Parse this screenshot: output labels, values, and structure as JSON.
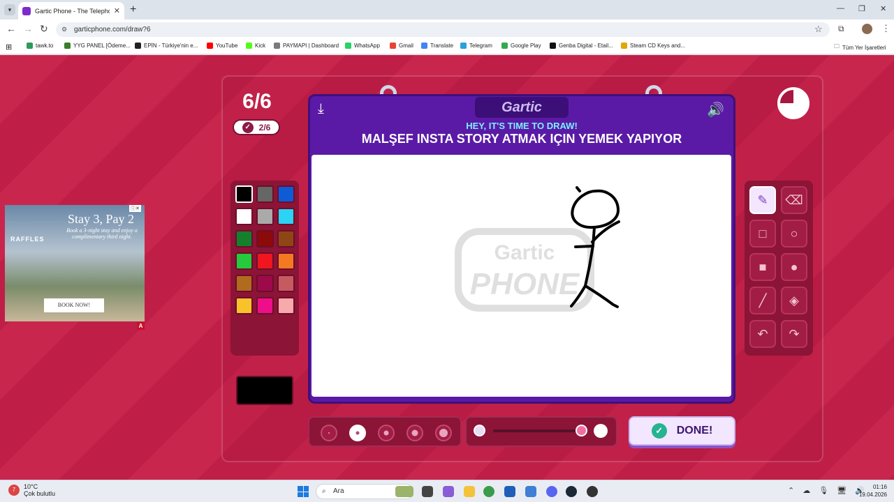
{
  "browser": {
    "tab_title": "Gartic Phone - The Telephone G",
    "url": "garticphone.com/draw?6",
    "bookmarks": [
      "tawk.to",
      "YYG PANEL [Ödeme...",
      "EPİN - Türkiye'nin e...",
      "YouTube",
      "Kick",
      "PAYMAPI | Dashboard",
      "WhatsApp",
      "Gmail",
      "Translate",
      "Telegram",
      "Google Play",
      "Genba Digital - Etail...",
      "Steam CD Keys and..."
    ],
    "bookmark_colors": [
      "#2e9b5a",
      "#3b7d2a",
      "#222222",
      "#ff0000",
      "#53fc18",
      "#7a7a7a",
      "#25d366",
      "#ea4335",
      "#4285f4",
      "#2aa1da",
      "#34a853",
      "#111111",
      "#e0a800"
    ],
    "all_bookmarks": "Tüm Yer İşaretleri"
  },
  "game": {
    "round": "6/6",
    "progress": "2/6",
    "logo": "Gartic",
    "prompt_top": "HEY, IT'S TIME TO DRAW!",
    "prompt_main": "MALŞEF INSTA STORY ATMAK IÇIN YEMEK YAPIYOR",
    "watermark_line1": "Gartic",
    "watermark_line2": "PHONE",
    "done_label": "DONE!",
    "timer_fraction_elapsed": 0.75,
    "palette": [
      "#000000",
      "#666666",
      "#0f5bd6",
      "#ffffff",
      "#aaaaaa",
      "#2bd3f5",
      "#14802c",
      "#8c0a0a",
      "#8e4714",
      "#26c93c",
      "#ef1620",
      "#f47a22",
      "#b06b1e",
      "#9c0a4a",
      "#c75a61",
      "#f9c22b",
      "#ef0e8a",
      "#f7a9ab"
    ],
    "current_color": "#000000",
    "tools": [
      "pen-tool",
      "eraser-tool",
      "rectangle-tool",
      "ellipse-tool",
      "filled-rectangle-tool",
      "filled-ellipse-tool",
      "line-tool",
      "fill-bucket-tool",
      "undo-tool",
      "redo-tool"
    ],
    "active_tool": "pen-tool",
    "brush_sizes": 5,
    "active_brush": 1
  },
  "ad": {
    "brand": "RAFFLES",
    "headline": "Stay 3, Pay 2",
    "subtext": "Book a 3-night stay and enjoy a complimentary third night.",
    "cta": "BOOK NOW!",
    "badge": "A"
  },
  "taskbar": {
    "temperature": "10°C",
    "weather": "Çok bulutlu",
    "weather_badge": "7",
    "search": "Ara",
    "time": "01:16",
    "date": "19.04.2026"
  }
}
